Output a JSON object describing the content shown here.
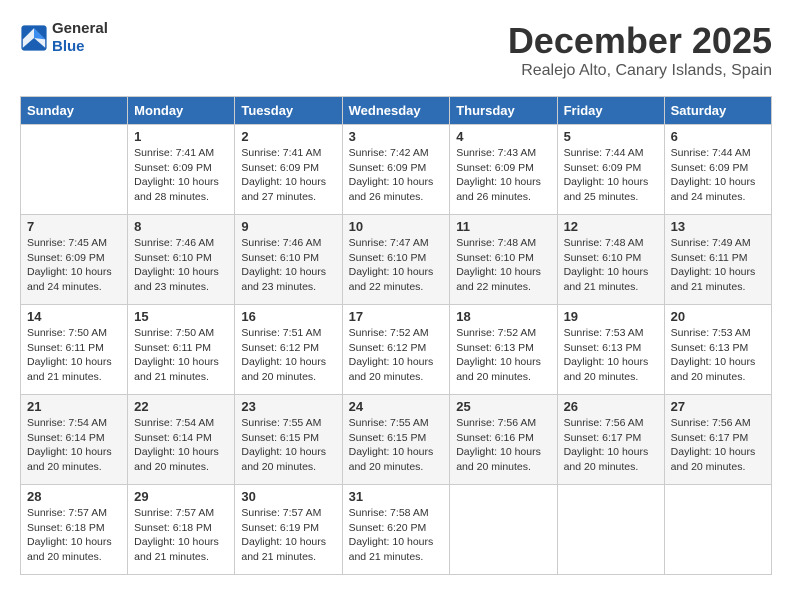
{
  "logo": {
    "line1": "General",
    "line2": "Blue",
    "tagline": ""
  },
  "title": "December 2025",
  "location": "Realejo Alto, Canary Islands, Spain",
  "weekdays": [
    "Sunday",
    "Monday",
    "Tuesday",
    "Wednesday",
    "Thursday",
    "Friday",
    "Saturday"
  ],
  "weeks": [
    [
      {
        "day": "",
        "sunrise": "",
        "sunset": "",
        "daylight": ""
      },
      {
        "day": "1",
        "sunrise": "Sunrise: 7:41 AM",
        "sunset": "Sunset: 6:09 PM",
        "daylight": "Daylight: 10 hours and 28 minutes."
      },
      {
        "day": "2",
        "sunrise": "Sunrise: 7:41 AM",
        "sunset": "Sunset: 6:09 PM",
        "daylight": "Daylight: 10 hours and 27 minutes."
      },
      {
        "day": "3",
        "sunrise": "Sunrise: 7:42 AM",
        "sunset": "Sunset: 6:09 PM",
        "daylight": "Daylight: 10 hours and 26 minutes."
      },
      {
        "day": "4",
        "sunrise": "Sunrise: 7:43 AM",
        "sunset": "Sunset: 6:09 PM",
        "daylight": "Daylight: 10 hours and 26 minutes."
      },
      {
        "day": "5",
        "sunrise": "Sunrise: 7:44 AM",
        "sunset": "Sunset: 6:09 PM",
        "daylight": "Daylight: 10 hours and 25 minutes."
      },
      {
        "day": "6",
        "sunrise": "Sunrise: 7:44 AM",
        "sunset": "Sunset: 6:09 PM",
        "daylight": "Daylight: 10 hours and 24 minutes."
      }
    ],
    [
      {
        "day": "7",
        "sunrise": "Sunrise: 7:45 AM",
        "sunset": "Sunset: 6:09 PM",
        "daylight": "Daylight: 10 hours and 24 minutes."
      },
      {
        "day": "8",
        "sunrise": "Sunrise: 7:46 AM",
        "sunset": "Sunset: 6:10 PM",
        "daylight": "Daylight: 10 hours and 23 minutes."
      },
      {
        "day": "9",
        "sunrise": "Sunrise: 7:46 AM",
        "sunset": "Sunset: 6:10 PM",
        "daylight": "Daylight: 10 hours and 23 minutes."
      },
      {
        "day": "10",
        "sunrise": "Sunrise: 7:47 AM",
        "sunset": "Sunset: 6:10 PM",
        "daylight": "Daylight: 10 hours and 22 minutes."
      },
      {
        "day": "11",
        "sunrise": "Sunrise: 7:48 AM",
        "sunset": "Sunset: 6:10 PM",
        "daylight": "Daylight: 10 hours and 22 minutes."
      },
      {
        "day": "12",
        "sunrise": "Sunrise: 7:48 AM",
        "sunset": "Sunset: 6:10 PM",
        "daylight": "Daylight: 10 hours and 21 minutes."
      },
      {
        "day": "13",
        "sunrise": "Sunrise: 7:49 AM",
        "sunset": "Sunset: 6:11 PM",
        "daylight": "Daylight: 10 hours and 21 minutes."
      }
    ],
    [
      {
        "day": "14",
        "sunrise": "Sunrise: 7:50 AM",
        "sunset": "Sunset: 6:11 PM",
        "daylight": "Daylight: 10 hours and 21 minutes."
      },
      {
        "day": "15",
        "sunrise": "Sunrise: 7:50 AM",
        "sunset": "Sunset: 6:11 PM",
        "daylight": "Daylight: 10 hours and 21 minutes."
      },
      {
        "day": "16",
        "sunrise": "Sunrise: 7:51 AM",
        "sunset": "Sunset: 6:12 PM",
        "daylight": "Daylight: 10 hours and 20 minutes."
      },
      {
        "day": "17",
        "sunrise": "Sunrise: 7:52 AM",
        "sunset": "Sunset: 6:12 PM",
        "daylight": "Daylight: 10 hours and 20 minutes."
      },
      {
        "day": "18",
        "sunrise": "Sunrise: 7:52 AM",
        "sunset": "Sunset: 6:13 PM",
        "daylight": "Daylight: 10 hours and 20 minutes."
      },
      {
        "day": "19",
        "sunrise": "Sunrise: 7:53 AM",
        "sunset": "Sunset: 6:13 PM",
        "daylight": "Daylight: 10 hours and 20 minutes."
      },
      {
        "day": "20",
        "sunrise": "Sunrise: 7:53 AM",
        "sunset": "Sunset: 6:13 PM",
        "daylight": "Daylight: 10 hours and 20 minutes."
      }
    ],
    [
      {
        "day": "21",
        "sunrise": "Sunrise: 7:54 AM",
        "sunset": "Sunset: 6:14 PM",
        "daylight": "Daylight: 10 hours and 20 minutes."
      },
      {
        "day": "22",
        "sunrise": "Sunrise: 7:54 AM",
        "sunset": "Sunset: 6:14 PM",
        "daylight": "Daylight: 10 hours and 20 minutes."
      },
      {
        "day": "23",
        "sunrise": "Sunrise: 7:55 AM",
        "sunset": "Sunset: 6:15 PM",
        "daylight": "Daylight: 10 hours and 20 minutes."
      },
      {
        "day": "24",
        "sunrise": "Sunrise: 7:55 AM",
        "sunset": "Sunset: 6:15 PM",
        "daylight": "Daylight: 10 hours and 20 minutes."
      },
      {
        "day": "25",
        "sunrise": "Sunrise: 7:56 AM",
        "sunset": "Sunset: 6:16 PM",
        "daylight": "Daylight: 10 hours and 20 minutes."
      },
      {
        "day": "26",
        "sunrise": "Sunrise: 7:56 AM",
        "sunset": "Sunset: 6:17 PM",
        "daylight": "Daylight: 10 hours and 20 minutes."
      },
      {
        "day": "27",
        "sunrise": "Sunrise: 7:56 AM",
        "sunset": "Sunset: 6:17 PM",
        "daylight": "Daylight: 10 hours and 20 minutes."
      }
    ],
    [
      {
        "day": "28",
        "sunrise": "Sunrise: 7:57 AM",
        "sunset": "Sunset: 6:18 PM",
        "daylight": "Daylight: 10 hours and 20 minutes."
      },
      {
        "day": "29",
        "sunrise": "Sunrise: 7:57 AM",
        "sunset": "Sunset: 6:18 PM",
        "daylight": "Daylight: 10 hours and 21 minutes."
      },
      {
        "day": "30",
        "sunrise": "Sunrise: 7:57 AM",
        "sunset": "Sunset: 6:19 PM",
        "daylight": "Daylight: 10 hours and 21 minutes."
      },
      {
        "day": "31",
        "sunrise": "Sunrise: 7:58 AM",
        "sunset": "Sunset: 6:20 PM",
        "daylight": "Daylight: 10 hours and 21 minutes."
      },
      {
        "day": "",
        "sunrise": "",
        "sunset": "",
        "daylight": ""
      },
      {
        "day": "",
        "sunrise": "",
        "sunset": "",
        "daylight": ""
      },
      {
        "day": "",
        "sunrise": "",
        "sunset": "",
        "daylight": ""
      }
    ]
  ]
}
